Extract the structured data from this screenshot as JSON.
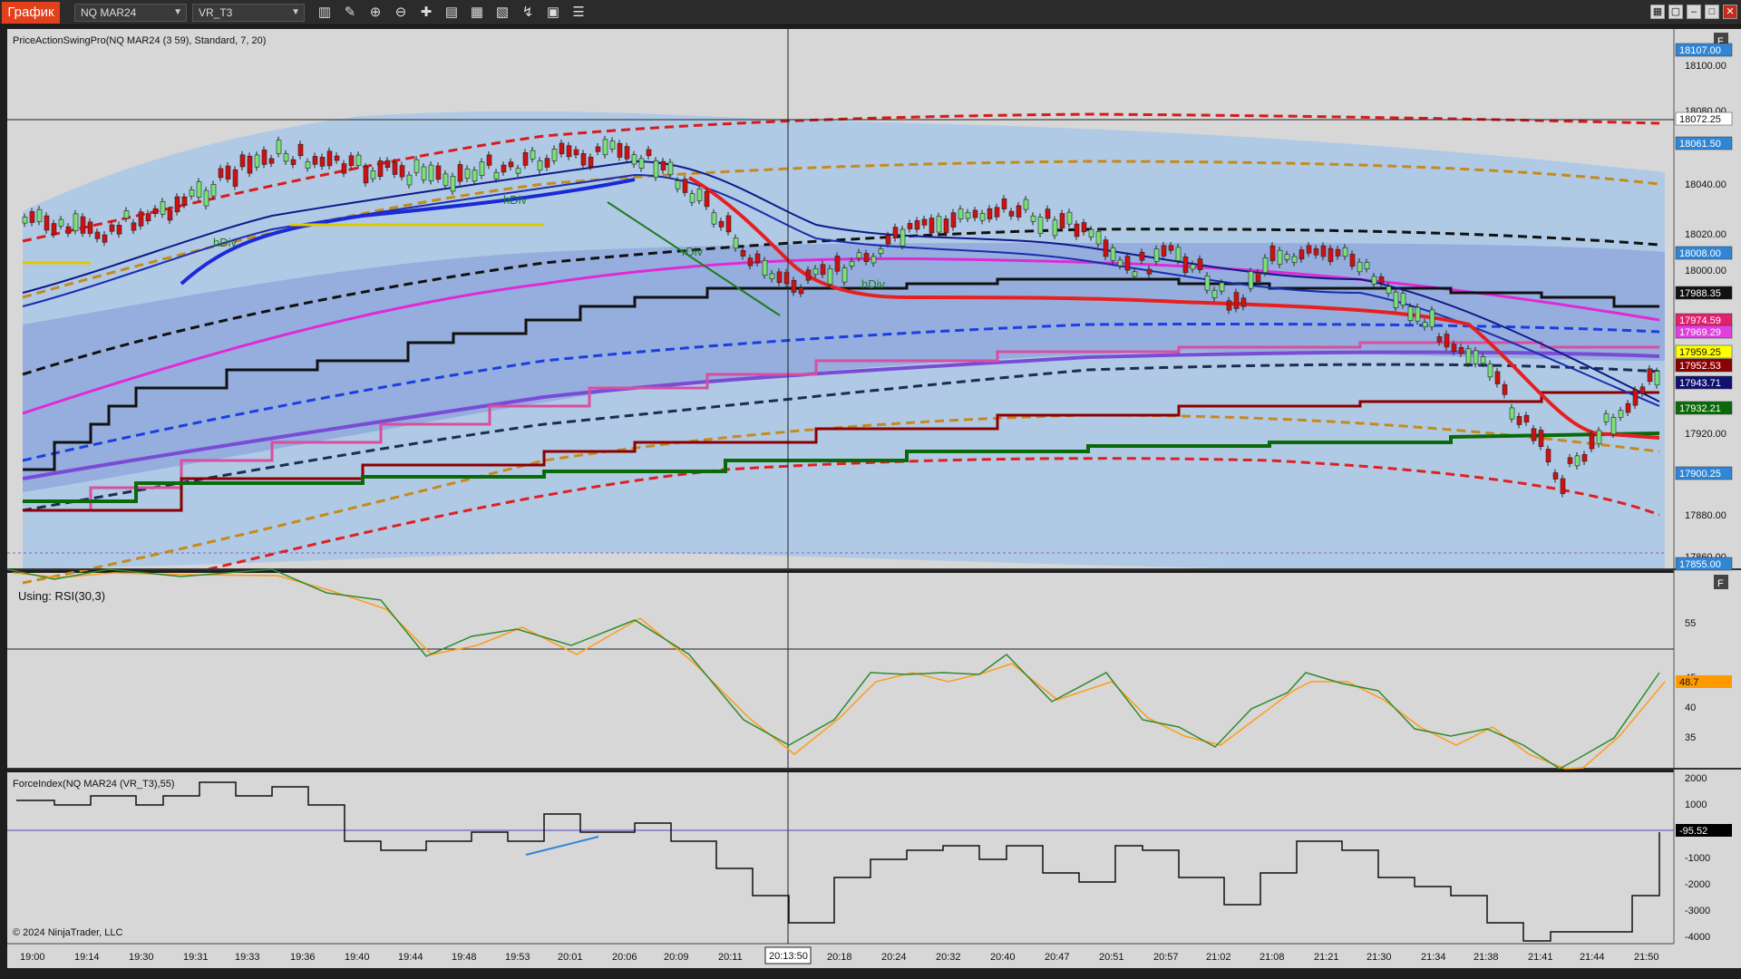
{
  "toolbar": {
    "chart_tab": "График",
    "instrument": "NQ MAR24",
    "period_type": "VR_T3",
    "tools": [
      "bar-type-icon",
      "draw-pencil-icon",
      "zoom-in-icon",
      "zoom-out-icon",
      "crosshair-icon",
      "properties-icon",
      "indicators-icon",
      "strategies-icon",
      "chart-trader-icon",
      "data-box-icon",
      "list-icon"
    ]
  },
  "window_buttons": [
    "tile-icon",
    "restore-icon",
    "minimize-icon",
    "maximize-icon",
    "close-icon"
  ],
  "panels": {
    "price": {
      "label": "PriceActionSwingPro(NQ MAR24 (3 59), Standard, 7, 20)",
      "f_button": "F",
      "y_ticks": [
        "18100.00",
        "18080.00",
        "18040.00",
        "18020.00",
        "18000.00",
        "17920.00",
        "17880.00",
        "17860.00"
      ],
      "markers": [
        {
          "text": "18107.00",
          "color": "#2f86d6"
        },
        {
          "text": "18072.25",
          "color": "#ffffff"
        },
        {
          "text": "18061.50",
          "color": "#2f86d6"
        },
        {
          "text": "18008.00",
          "color": "#2f86d6"
        },
        {
          "text": "17988.35",
          "color": "#111111"
        },
        {
          "text": "17974.59",
          "color": "#e02070"
        },
        {
          "text": "17969.29",
          "color": "#e040e0"
        },
        {
          "text": "17959.25",
          "color": "#ffff00"
        },
        {
          "text": "17952.53",
          "color": "#8b0000"
        },
        {
          "text": "17943.71",
          "color": "#101070"
        },
        {
          "text": "17932.21",
          "color": "#0a6a0a"
        },
        {
          "text": "17900.25",
          "color": "#2f86d6"
        },
        {
          "text": "17855.00",
          "color": "#2f86d6"
        }
      ],
      "div_labels": [
        "hDiv",
        "hDiv",
        "rDiv",
        "hDiv"
      ]
    },
    "rsi": {
      "label": "Using: RSI(30,3)",
      "f_button": "F",
      "y_ticks": [
        "55",
        "45",
        "40",
        "35"
      ],
      "marker": {
        "text": "48.7",
        "color": "#ff9900"
      }
    },
    "force": {
      "label": "ForceIndex(NQ MAR24 (VR_T3),55)",
      "y_ticks": [
        "2000",
        "1000",
        "-1000",
        "-2000",
        "-3000",
        "-4000"
      ],
      "marker": {
        "text": "-95.52",
        "color": "#000000"
      },
      "copyright": "© 2024 NinjaTrader, LLC"
    }
  },
  "x_axis": {
    "labels": [
      "19:00",
      "19:14",
      "19:30",
      "19:31",
      "19:33",
      "19:36",
      "19:40",
      "19:44",
      "19:48",
      "19:53",
      "20:01",
      "20:06",
      "20:09",
      "20:11",
      "20:18",
      "20:24",
      "20:32",
      "20:40",
      "20:47",
      "20:51",
      "20:57",
      "21:02",
      "21:08",
      "21:21",
      "21:30",
      "21:34",
      "21:38",
      "21:41",
      "21:44",
      "21:50"
    ],
    "cursor_time": "20:13:50"
  },
  "colors": {
    "background": "#d7d7d7",
    "band_light": "#a9c8e9",
    "band_mid": "#8fa6dc",
    "accent_tab": "#e1401a"
  }
}
